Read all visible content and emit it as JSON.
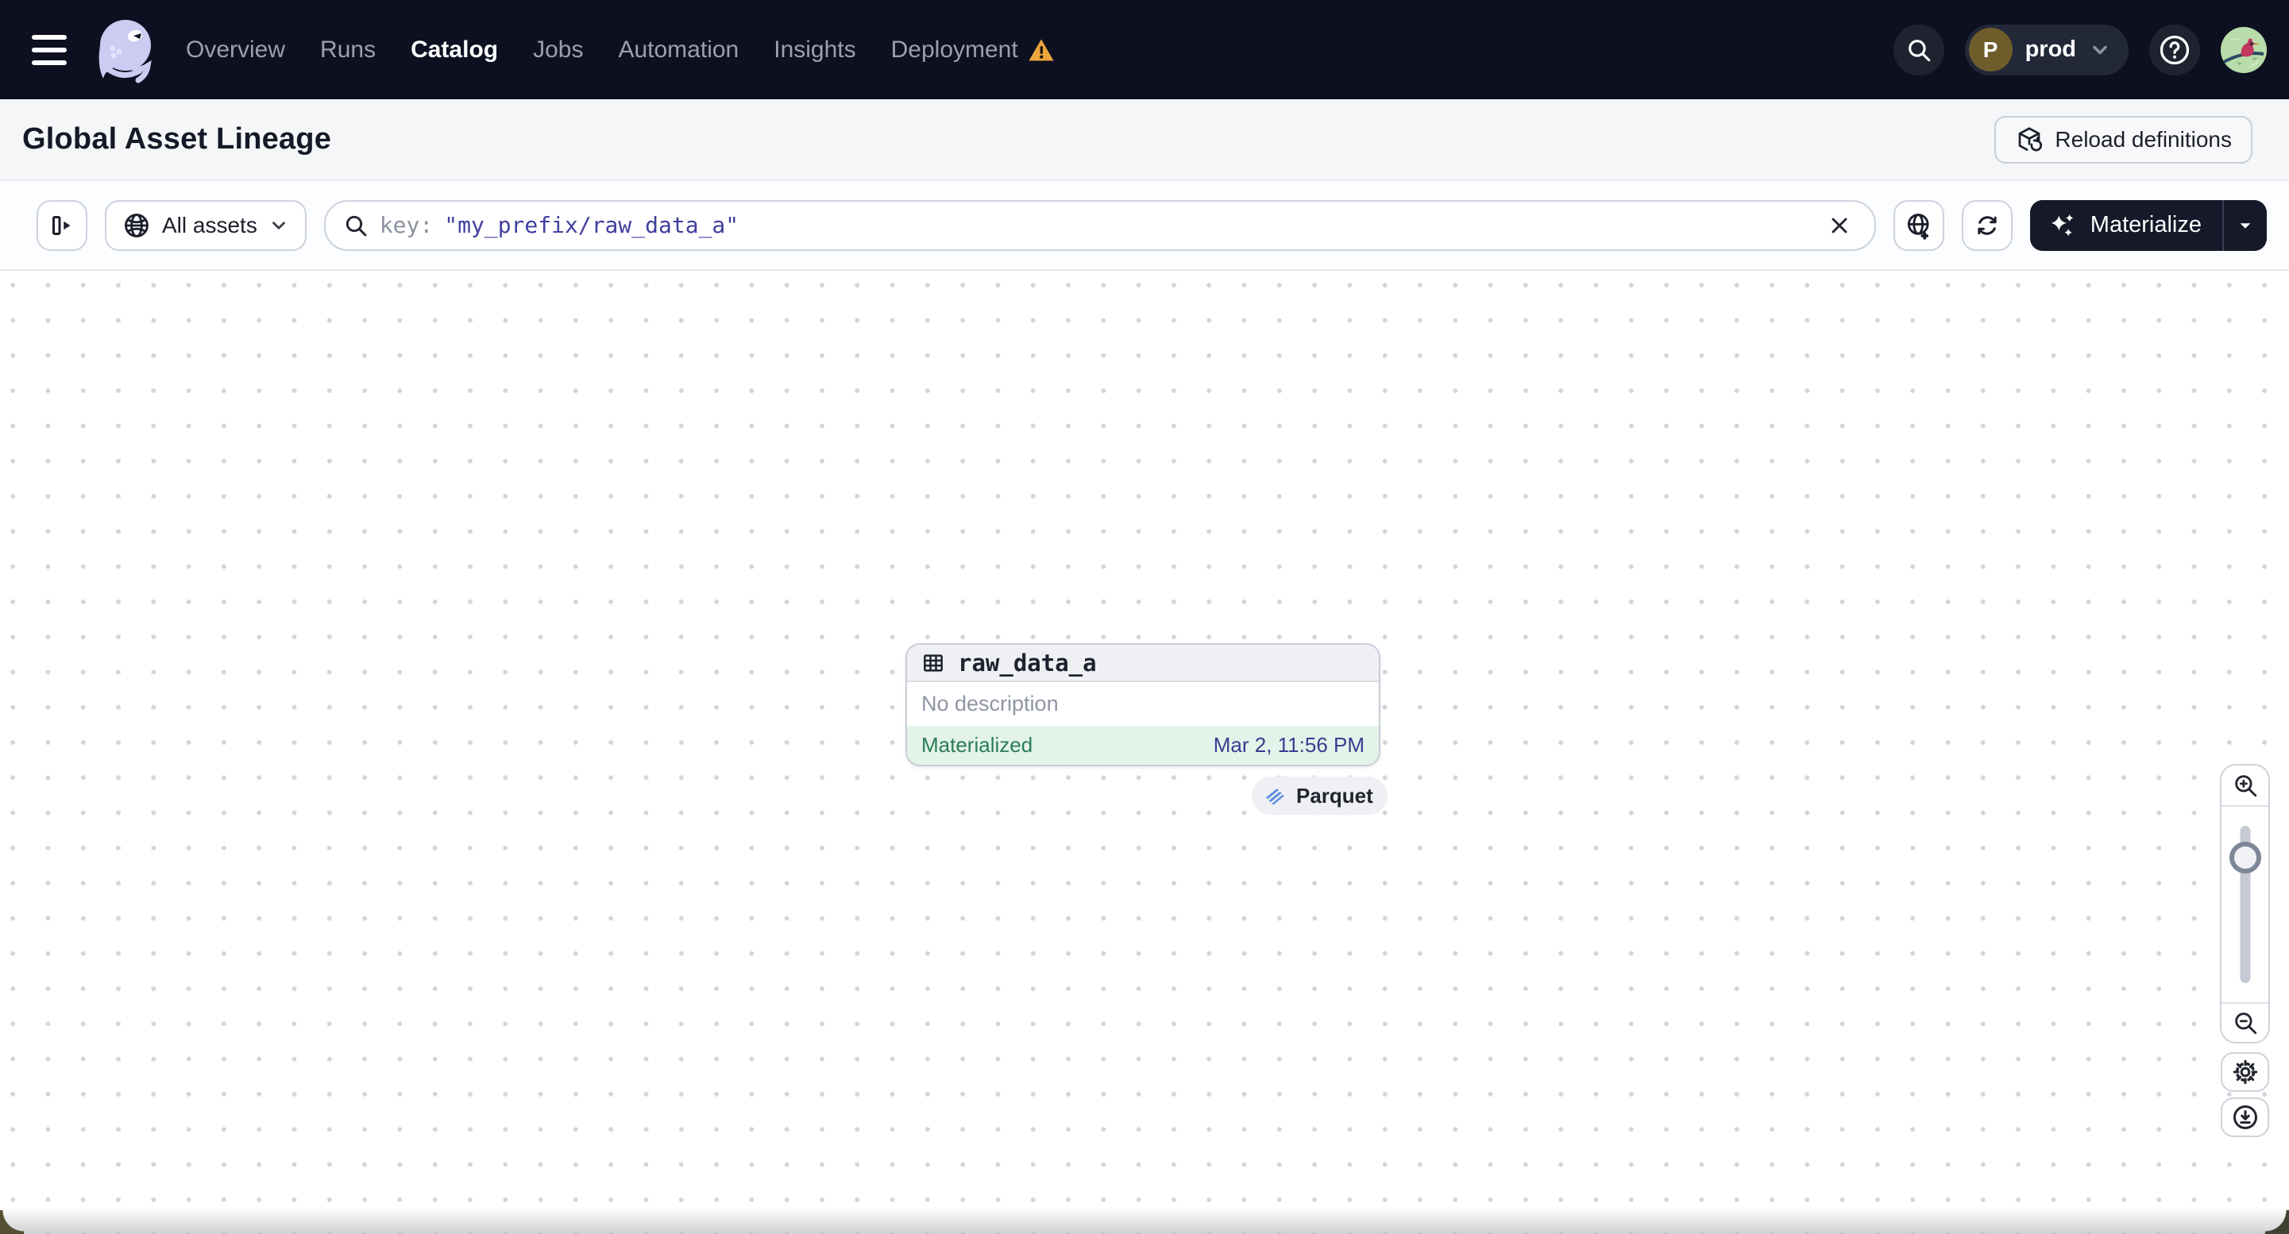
{
  "nav": {
    "items": [
      {
        "label": "Overview",
        "active": false
      },
      {
        "label": "Runs",
        "active": false
      },
      {
        "label": "Catalog",
        "active": true
      },
      {
        "label": "Jobs",
        "active": false
      },
      {
        "label": "Automation",
        "active": false
      },
      {
        "label": "Insights",
        "active": false
      },
      {
        "label": "Deployment",
        "active": false,
        "warning": true
      }
    ],
    "environment": {
      "initial": "P",
      "name": "prod"
    }
  },
  "header": {
    "title": "Global Asset Lineage",
    "reload_label": "Reload definitions"
  },
  "toolbar": {
    "scope_label": "All assets",
    "search": {
      "prefix": "key:",
      "value": "\"my_prefix/raw_data_a\""
    },
    "materialize_label": "Materialize"
  },
  "graph": {
    "node": {
      "title": "raw_data_a",
      "description": "No description",
      "status": "Materialized",
      "timestamp": "Mar 2, 11:56 PM",
      "tag": "Parquet"
    }
  },
  "icons": {
    "nav_warning": "warning-triangle",
    "materialize": "sparkles",
    "tag": "parquet-logo"
  },
  "colors": {
    "nav_bg": "#0d1020",
    "accent_dark": "#151929",
    "status_green_bg": "#e3f3e9",
    "status_green_text": "#2b7d55",
    "timestamp_indigo": "#373d90",
    "query_indigo": "#403f9f",
    "warning_orange": "#eba33c",
    "logo_lavender": "#ccccf2"
  }
}
